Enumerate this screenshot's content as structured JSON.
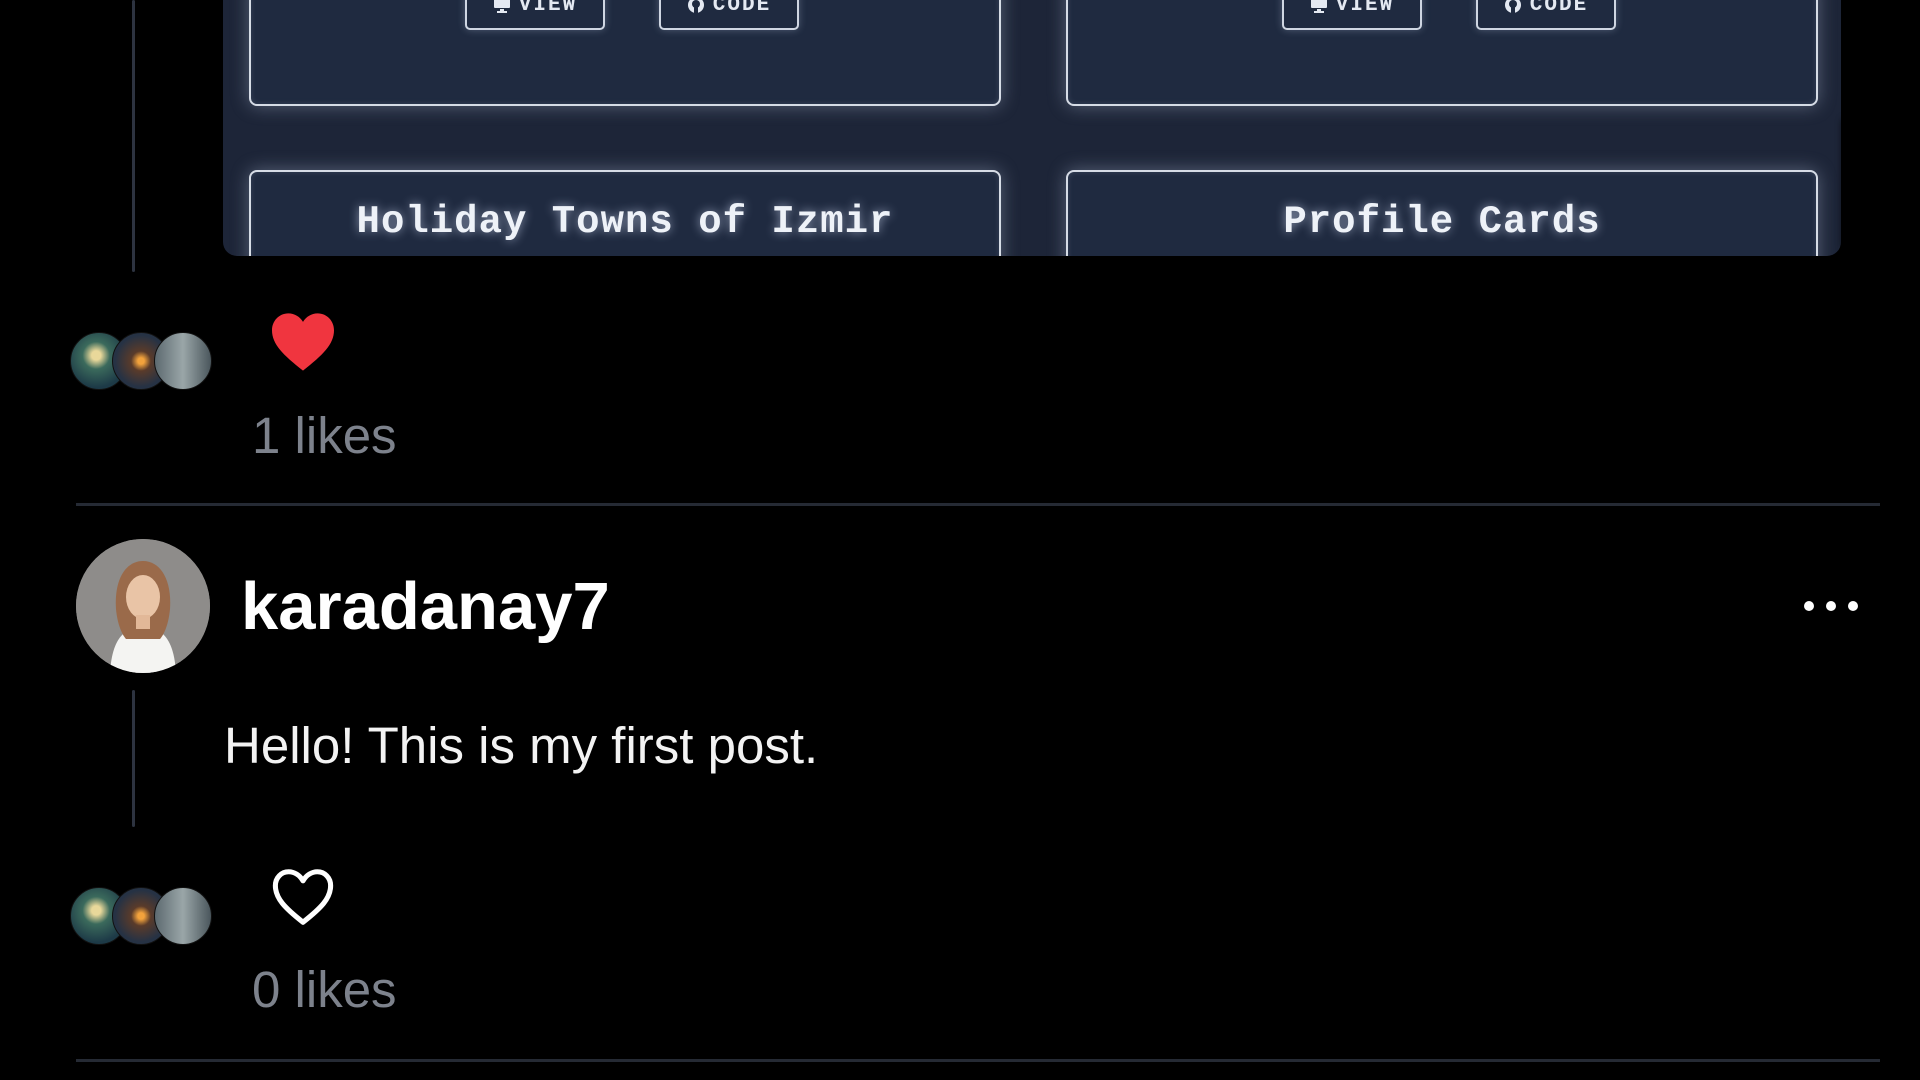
{
  "preview": {
    "cards": [
      {
        "title": "",
        "buttons": [
          {
            "label": "VIEW",
            "icon": "monitor-icon"
          },
          {
            "label": "CODE",
            "icon": "github-icon"
          }
        ]
      },
      {
        "title": "",
        "buttons": [
          {
            "label": "VIEW",
            "icon": "monitor-icon"
          },
          {
            "label": "CODE",
            "icon": "github-icon"
          }
        ]
      },
      {
        "title": "Holiday Towns of Izmir"
      },
      {
        "title": "Profile Cards"
      }
    ]
  },
  "posts": [
    {
      "liked": true,
      "likes_label": "1 likes",
      "heart_color": "#f0353f"
    },
    {
      "username": "karadanay7",
      "text": "Hello! This is my first post.",
      "liked": false,
      "likes_label": "0 likes"
    }
  ],
  "colors": {
    "background": "#000000",
    "card": "#1f2a40",
    "divider": "#252a34",
    "muted": "#7d828c"
  }
}
